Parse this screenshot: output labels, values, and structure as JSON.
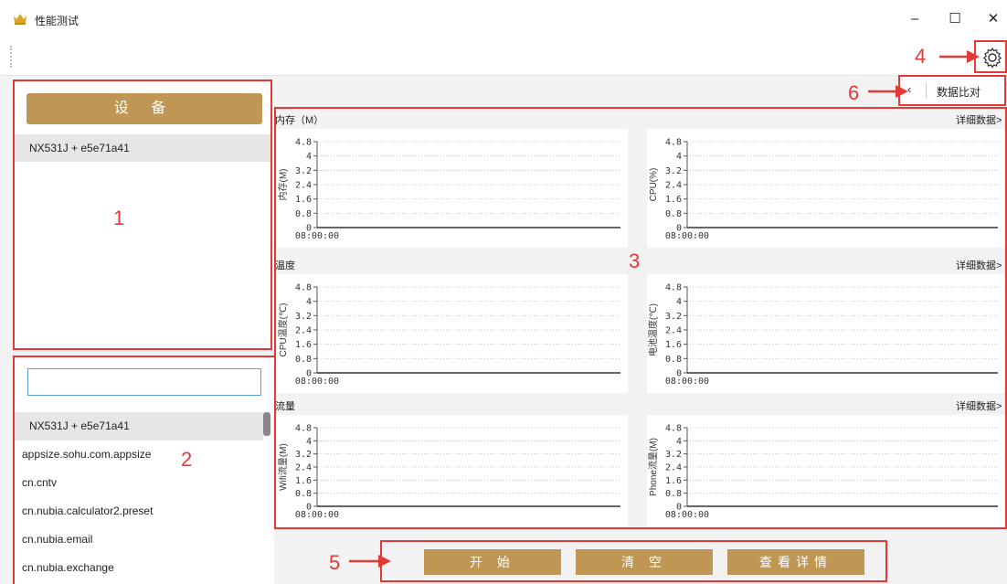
{
  "window": {
    "title": "性能测试",
    "controls": {
      "minimize": "–",
      "maximize": "☐",
      "close": "✕"
    }
  },
  "device_panel": {
    "button_label": "设 备",
    "devices": [
      "NX531J + e5e71a41"
    ]
  },
  "app_panel": {
    "search_value": "",
    "apps": [
      "NX531J + e5e71a41",
      "appsize.sohu.com.appsize",
      "cn.cntv",
      "cn.nubia.calculator2.preset",
      "cn.nubia.email",
      "cn.nubia.exchange"
    ],
    "selected_index": 0
  },
  "compare": {
    "chevron": "‹",
    "label": "数据比对"
  },
  "sections": [
    {
      "title": "内存（M）",
      "detail": "详细数据>"
    },
    {
      "title": "温度",
      "detail": "详细数据>"
    },
    {
      "title": "流量",
      "detail": "详细数据>"
    }
  ],
  "chart_data": [
    {
      "type": "line",
      "ylabel": "内存(M)",
      "yticks": [
        "4.8",
        "4",
        "3.2",
        "2.4",
        "1.6",
        "0.8",
        "0"
      ],
      "xticks": [
        "08:00:00"
      ],
      "ylim": [
        0,
        4.8
      ],
      "series": []
    },
    {
      "type": "line",
      "ylabel": "CPU(%)",
      "yticks": [
        "4.8",
        "4",
        "3.2",
        "2.4",
        "1.6",
        "0.8",
        "0"
      ],
      "xticks": [
        "08:00:00"
      ],
      "ylim": [
        0,
        4.8
      ],
      "series": []
    },
    {
      "type": "line",
      "ylabel": "CPU温度(℃)",
      "yticks": [
        "4.8",
        "4",
        "3.2",
        "2.4",
        "1.6",
        "0.8",
        "0"
      ],
      "xticks": [
        "08:00:00"
      ],
      "ylim": [
        0,
        4.8
      ],
      "series": []
    },
    {
      "type": "line",
      "ylabel": "电池温度(℃)",
      "yticks": [
        "4.8",
        "4",
        "3.2",
        "2.4",
        "1.6",
        "0.8",
        "0"
      ],
      "xticks": [
        "08:00:00"
      ],
      "ylim": [
        0,
        4.8
      ],
      "series": []
    },
    {
      "type": "line",
      "ylabel": "Wifi流量(M)",
      "yticks": [
        "4.8",
        "4",
        "3.2",
        "2.4",
        "1.6",
        "0.8",
        "0"
      ],
      "xticks": [
        "08:00:00"
      ],
      "ylim": [
        0,
        4.8
      ],
      "series": []
    },
    {
      "type": "line",
      "ylabel": "Phone流量(M)",
      "yticks": [
        "4.8",
        "4",
        "3.2",
        "2.4",
        "1.6",
        "0.8",
        "0"
      ],
      "xticks": [
        "08:00:00"
      ],
      "ylim": [
        0,
        4.8
      ],
      "series": []
    }
  ],
  "actions": {
    "start": "开 始",
    "clear": "清 空",
    "details": "查看详情"
  },
  "annotations": {
    "m1": "1",
    "m2": "2",
    "m3": "3",
    "m4": "4",
    "m5": "5",
    "m6": "6"
  },
  "colors": {
    "accent": "#bf9653",
    "annotation": "#e53935",
    "panel_bg": "#f2f2f2"
  },
  "icons": {
    "app": "crown-icon",
    "settings": "gear-icon"
  }
}
